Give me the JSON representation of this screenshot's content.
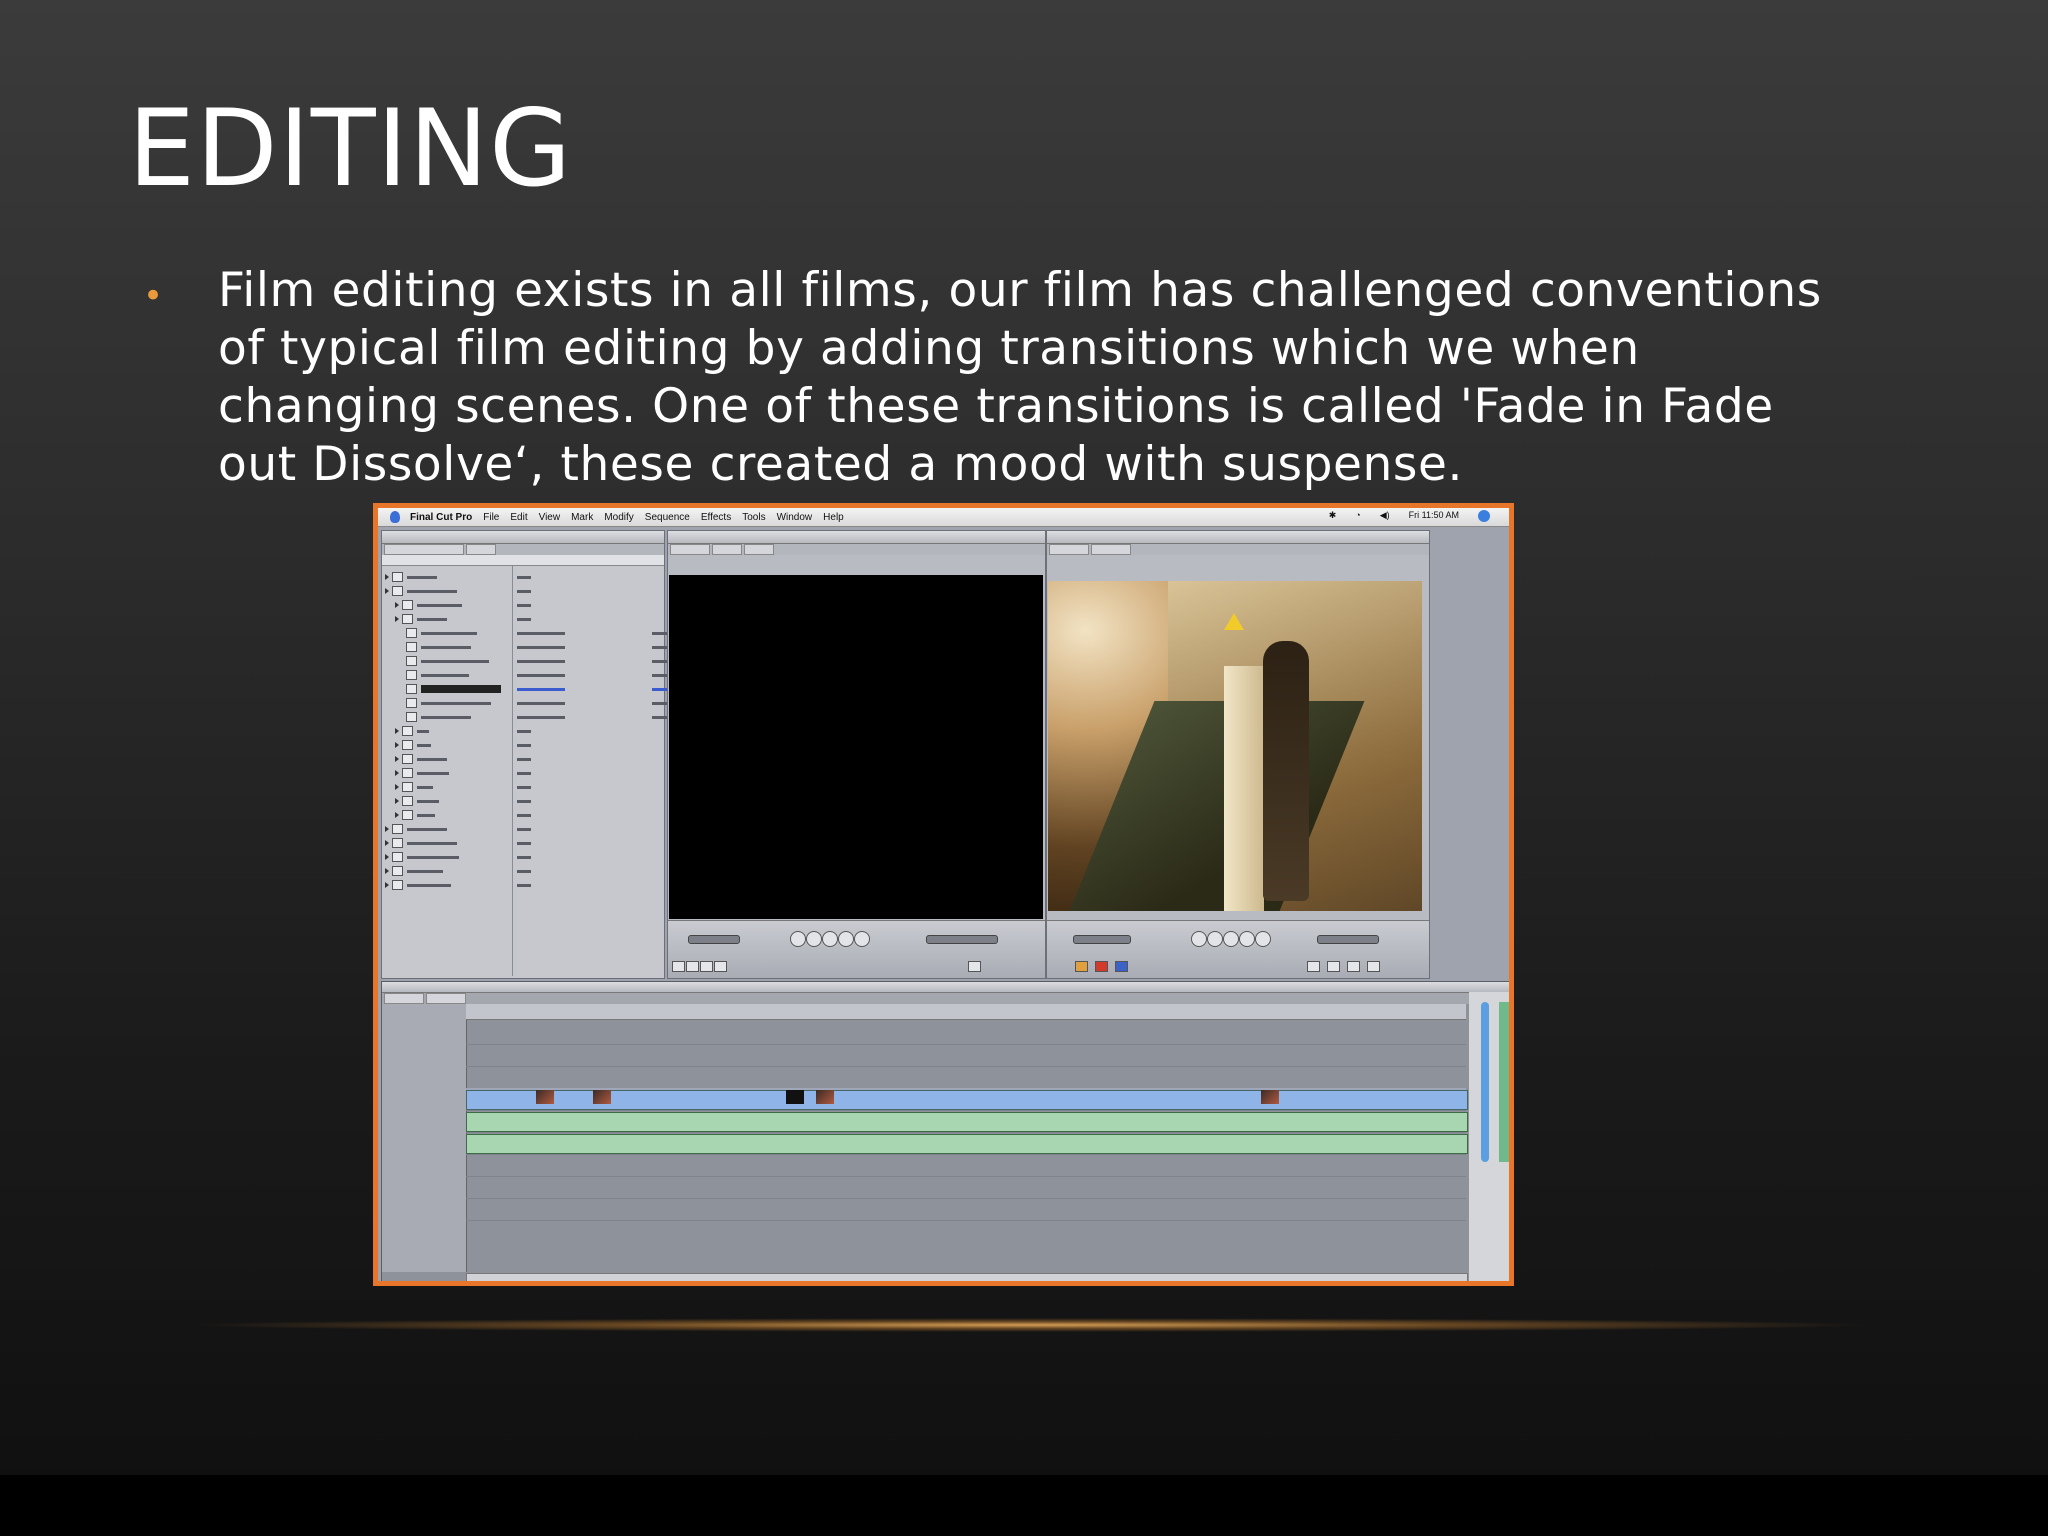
{
  "slide": {
    "title": "EDITING",
    "bullet_text": "Film editing exists in all films, our film has challenged conventions of typical film editing by adding transitions which we when changing scenes. One of these transitions is called 'Fade in Fade out Dissolve‘, these created a mood with suspense.",
    "accent_color": "#e8762a",
    "bullet_color": "#e89a3c"
  },
  "screenshot": {
    "app_name": "Final Cut Pro",
    "menu": [
      "File",
      "Edit",
      "View",
      "Mark",
      "Modify",
      "Sequence",
      "Effects",
      "Tools",
      "Window",
      "Help"
    ],
    "clock": "Fri 11:50 AM",
    "icons": [
      "apple-icon",
      "bluetooth-icon",
      "wifi-icon",
      "volume-icon",
      "spotlight-icon",
      "warning-icon"
    ]
  }
}
